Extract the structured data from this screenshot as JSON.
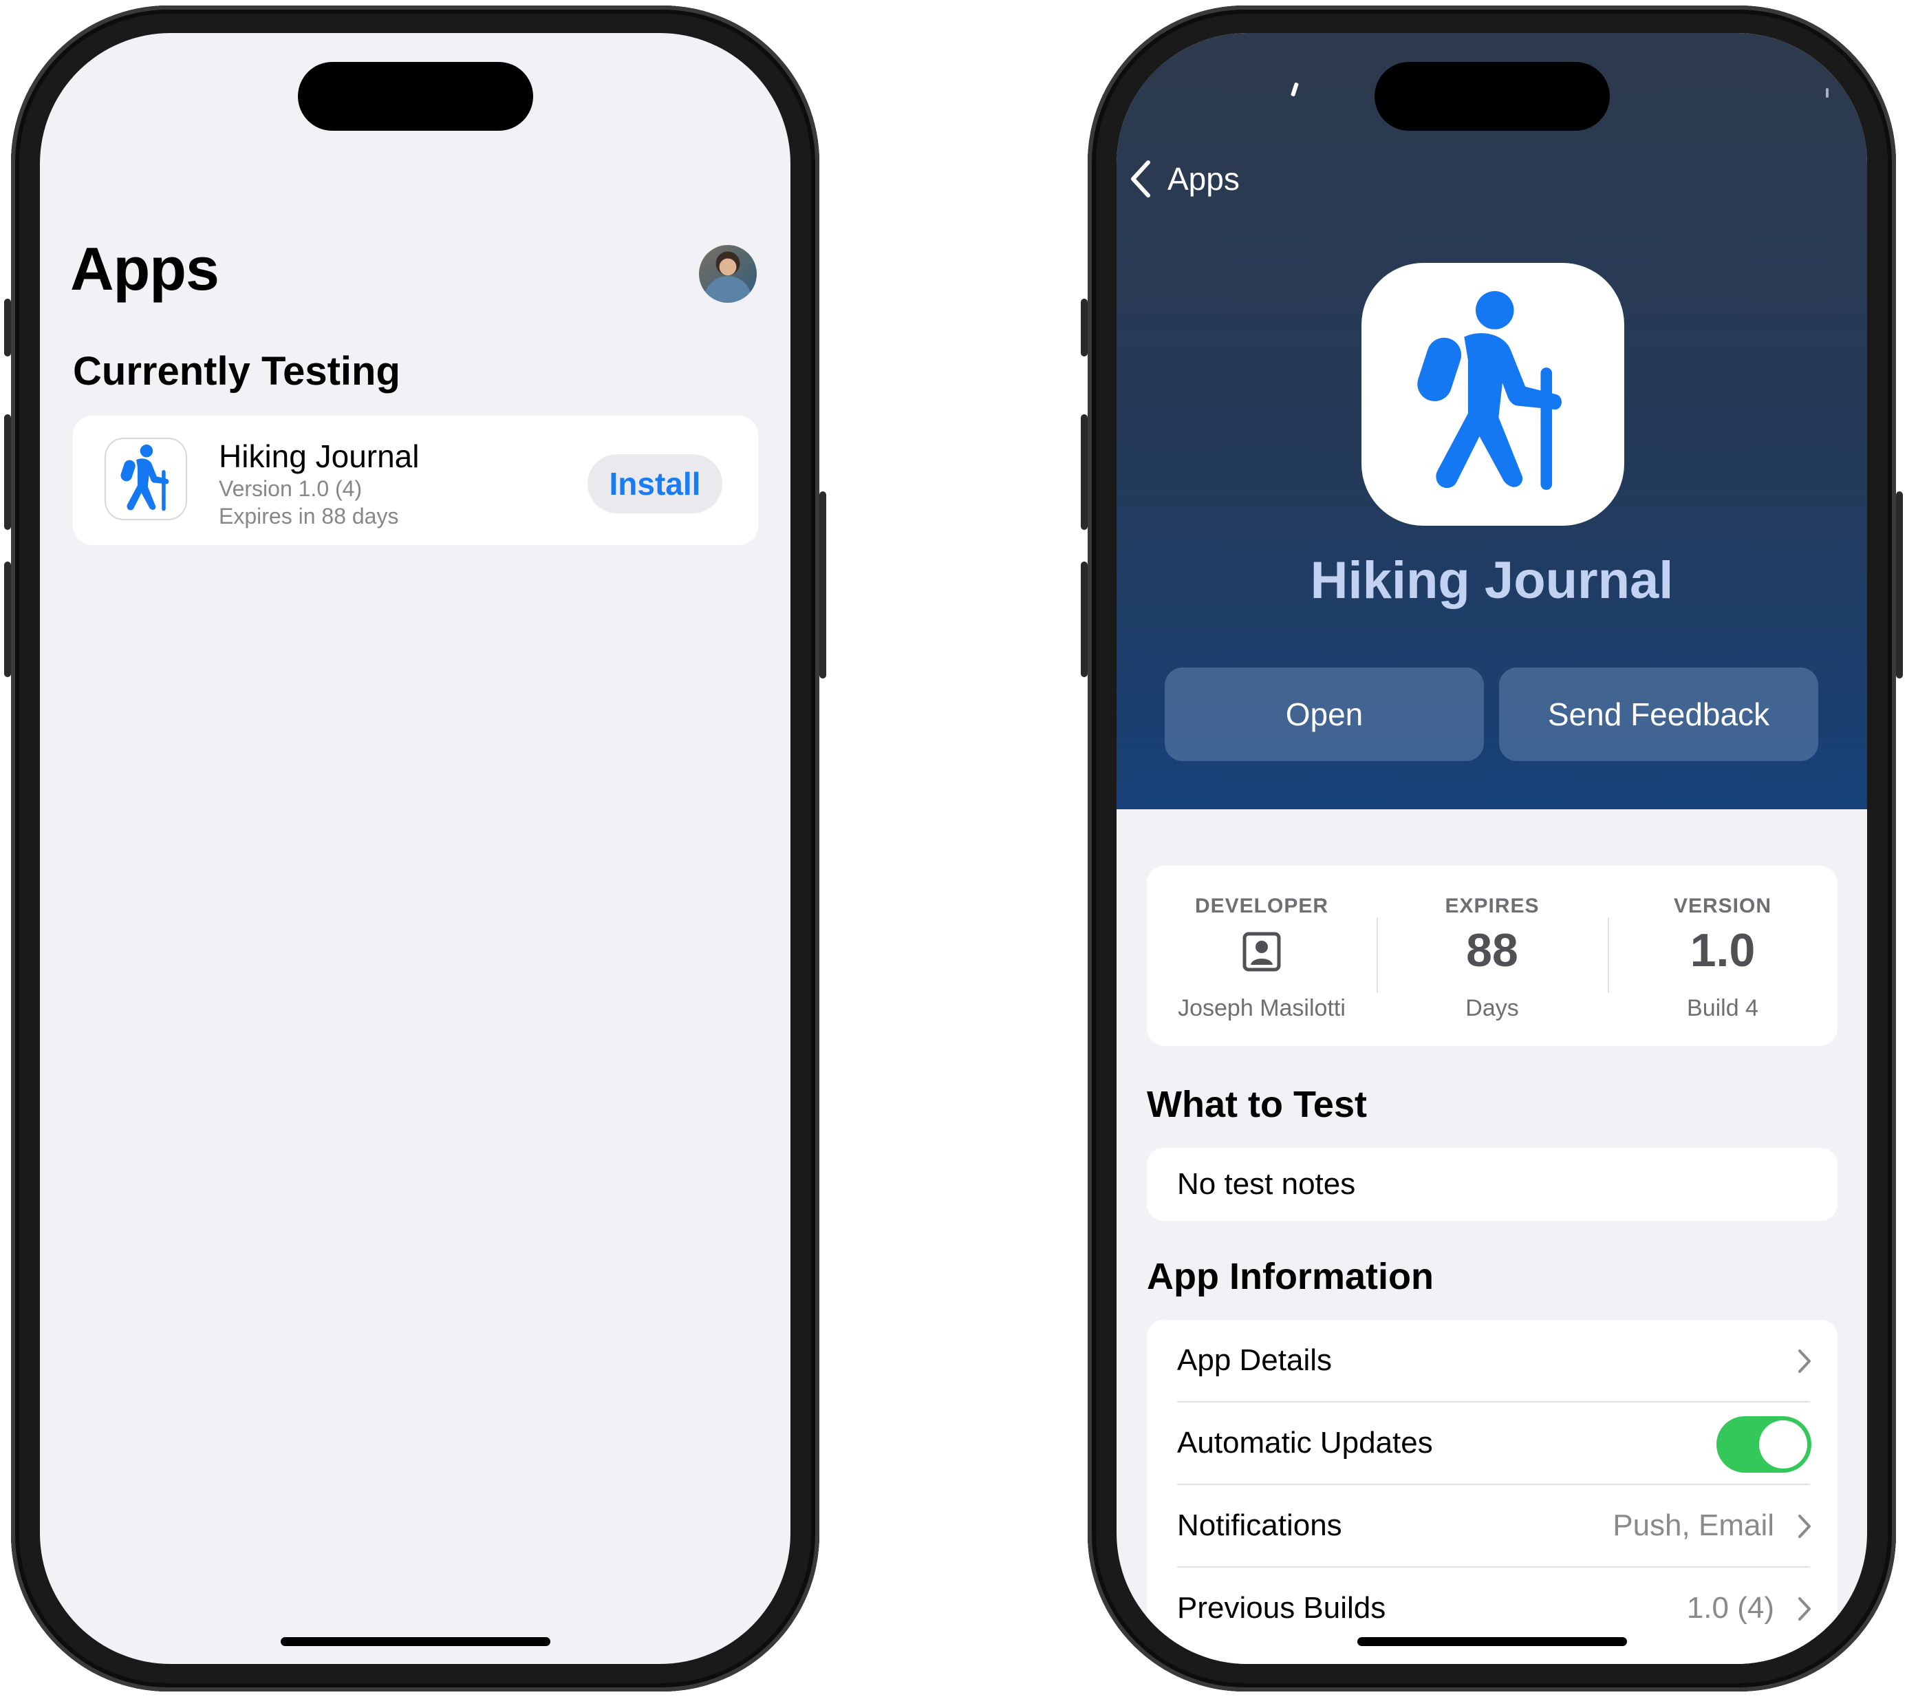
{
  "left_screen": {
    "title": "Apps",
    "section_title": "Currently Testing",
    "app": {
      "name": "Hiking Journal",
      "version": "Version 1.0 (4)",
      "expires": "Expires in 88 days",
      "install_label": "Install"
    }
  },
  "right_screen": {
    "back_label": "Apps",
    "app_name": "Hiking Journal",
    "open_label": "Open",
    "feedback_label": "Send Feedback",
    "info": {
      "developer_label": "DEVELOPER",
      "developer_name": "Joseph Masilotti",
      "expires_label": "EXPIRES",
      "expires_value": "88",
      "expires_unit": "Days",
      "version_label": "VERSION",
      "version_value": "1.0",
      "build": "Build 4"
    },
    "what_to_test_title": "What to Test",
    "test_notes": "No test notes",
    "app_info_title": "App Information",
    "rows": [
      {
        "label": "App Details",
        "value": ""
      },
      {
        "label": "Automatic Updates",
        "value": ""
      },
      {
        "label": "Notifications",
        "value": "Push, Email"
      },
      {
        "label": "Previous Builds",
        "value": "1.0 (4)"
      }
    ],
    "automatic_updates_on": true
  },
  "colors": {
    "accent": "#1a7cf5",
    "toggle_on": "#34c85a",
    "hero_top": "#2e3a4d",
    "hero_bottom": "#17427a",
    "icon_blue": "#1478f2"
  },
  "icons": [
    "hiker-icon",
    "avatar-photo",
    "chevron-left-icon",
    "person-card-icon",
    "chevron-right-icon"
  ]
}
